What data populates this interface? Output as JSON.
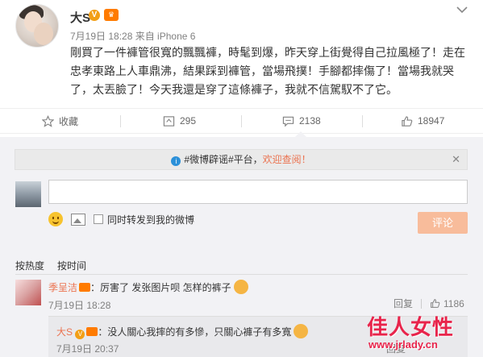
{
  "post": {
    "author": "大S",
    "v_badge": "V",
    "meta": "7月19日 18:28 来自 iPhone 6",
    "content": "剛買了一件褲管很寬的飄飄褲，時髦到爆，昨天穿上街覺得自己拉風極了！走在忠孝東路上人車鼎沸，結果踩到褲管，當場飛撲！手腳都摔傷了！當場我就哭了，太丟臉了！今天我還是穿了這條褲子，我就不信駕馭不了它。"
  },
  "actions": {
    "favorite": "收藏",
    "repost": "295",
    "comment": "2138",
    "like": "18947"
  },
  "notice": {
    "prefix": "#微博辟谣#平台，",
    "link": "欢迎查阅！",
    "close": "✕"
  },
  "composer": {
    "sync_label": "同时转发到我的微博",
    "submit": "评论"
  },
  "sort": {
    "hot": "按热度",
    "time": "按时间"
  },
  "comment": {
    "user": "季呈洁",
    "text": "：厉害了 发张图片呗 怎样的裤子",
    "time": "7月19日 18:28",
    "reply": "回复",
    "likes": "1186"
  },
  "reply": {
    "user": "大S",
    "v_badge": "V",
    "text": "：没人關心我摔的有多慘，只關心褲子有多寬",
    "time": "7月19日 20:37",
    "reply": "回复"
  },
  "watermark": {
    "title": "佳人女性",
    "url": "www.jrlady.cn"
  },
  "colors": {
    "accent": "#eb7350",
    "badge": "#f29f16",
    "submit_disabled": "#f8bc9b",
    "panel": "#f2f2f5",
    "watermark": "#e8244b"
  }
}
